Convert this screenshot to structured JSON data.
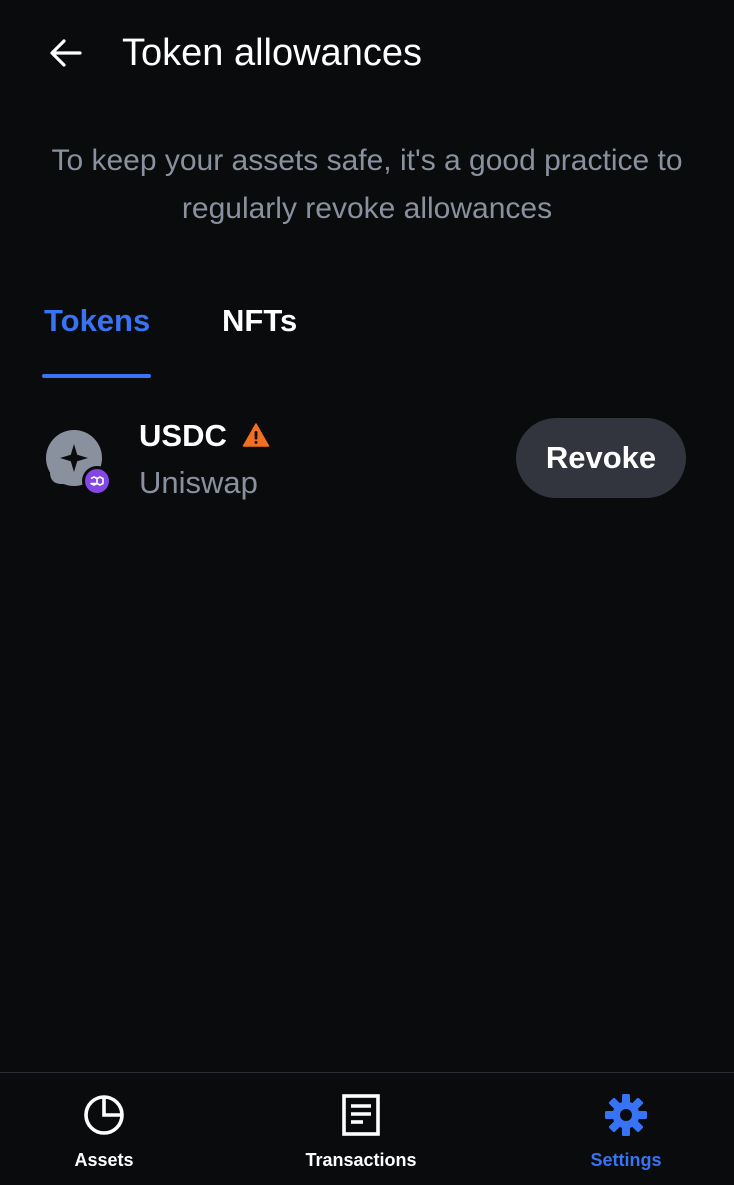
{
  "header": {
    "title": "Token allowances",
    "back_icon": "arrow-left-icon"
  },
  "description": "To keep your assets safe, it's a good practice to regularly revoke allowances",
  "tabs": [
    {
      "label": "Tokens",
      "active": true
    },
    {
      "label": "NFTs",
      "active": false
    }
  ],
  "allowances": [
    {
      "token": "USDC",
      "spender": "Uniswap",
      "warning": true,
      "network_badge": "polygon-icon",
      "action_label": "Revoke"
    }
  ],
  "bottom_nav": [
    {
      "label": "Assets",
      "icon": "pie-chart-icon",
      "active": false
    },
    {
      "label": "Transactions",
      "icon": "document-icon",
      "active": false
    },
    {
      "label": "Settings",
      "icon": "gear-icon",
      "active": true
    }
  ],
  "colors": {
    "background": "#0a0b0d",
    "accent": "#3773f5",
    "muted_text": "#8a919e",
    "button_bg": "#32353d",
    "warning": "#f26f21",
    "network_badge": "#8247e5"
  }
}
